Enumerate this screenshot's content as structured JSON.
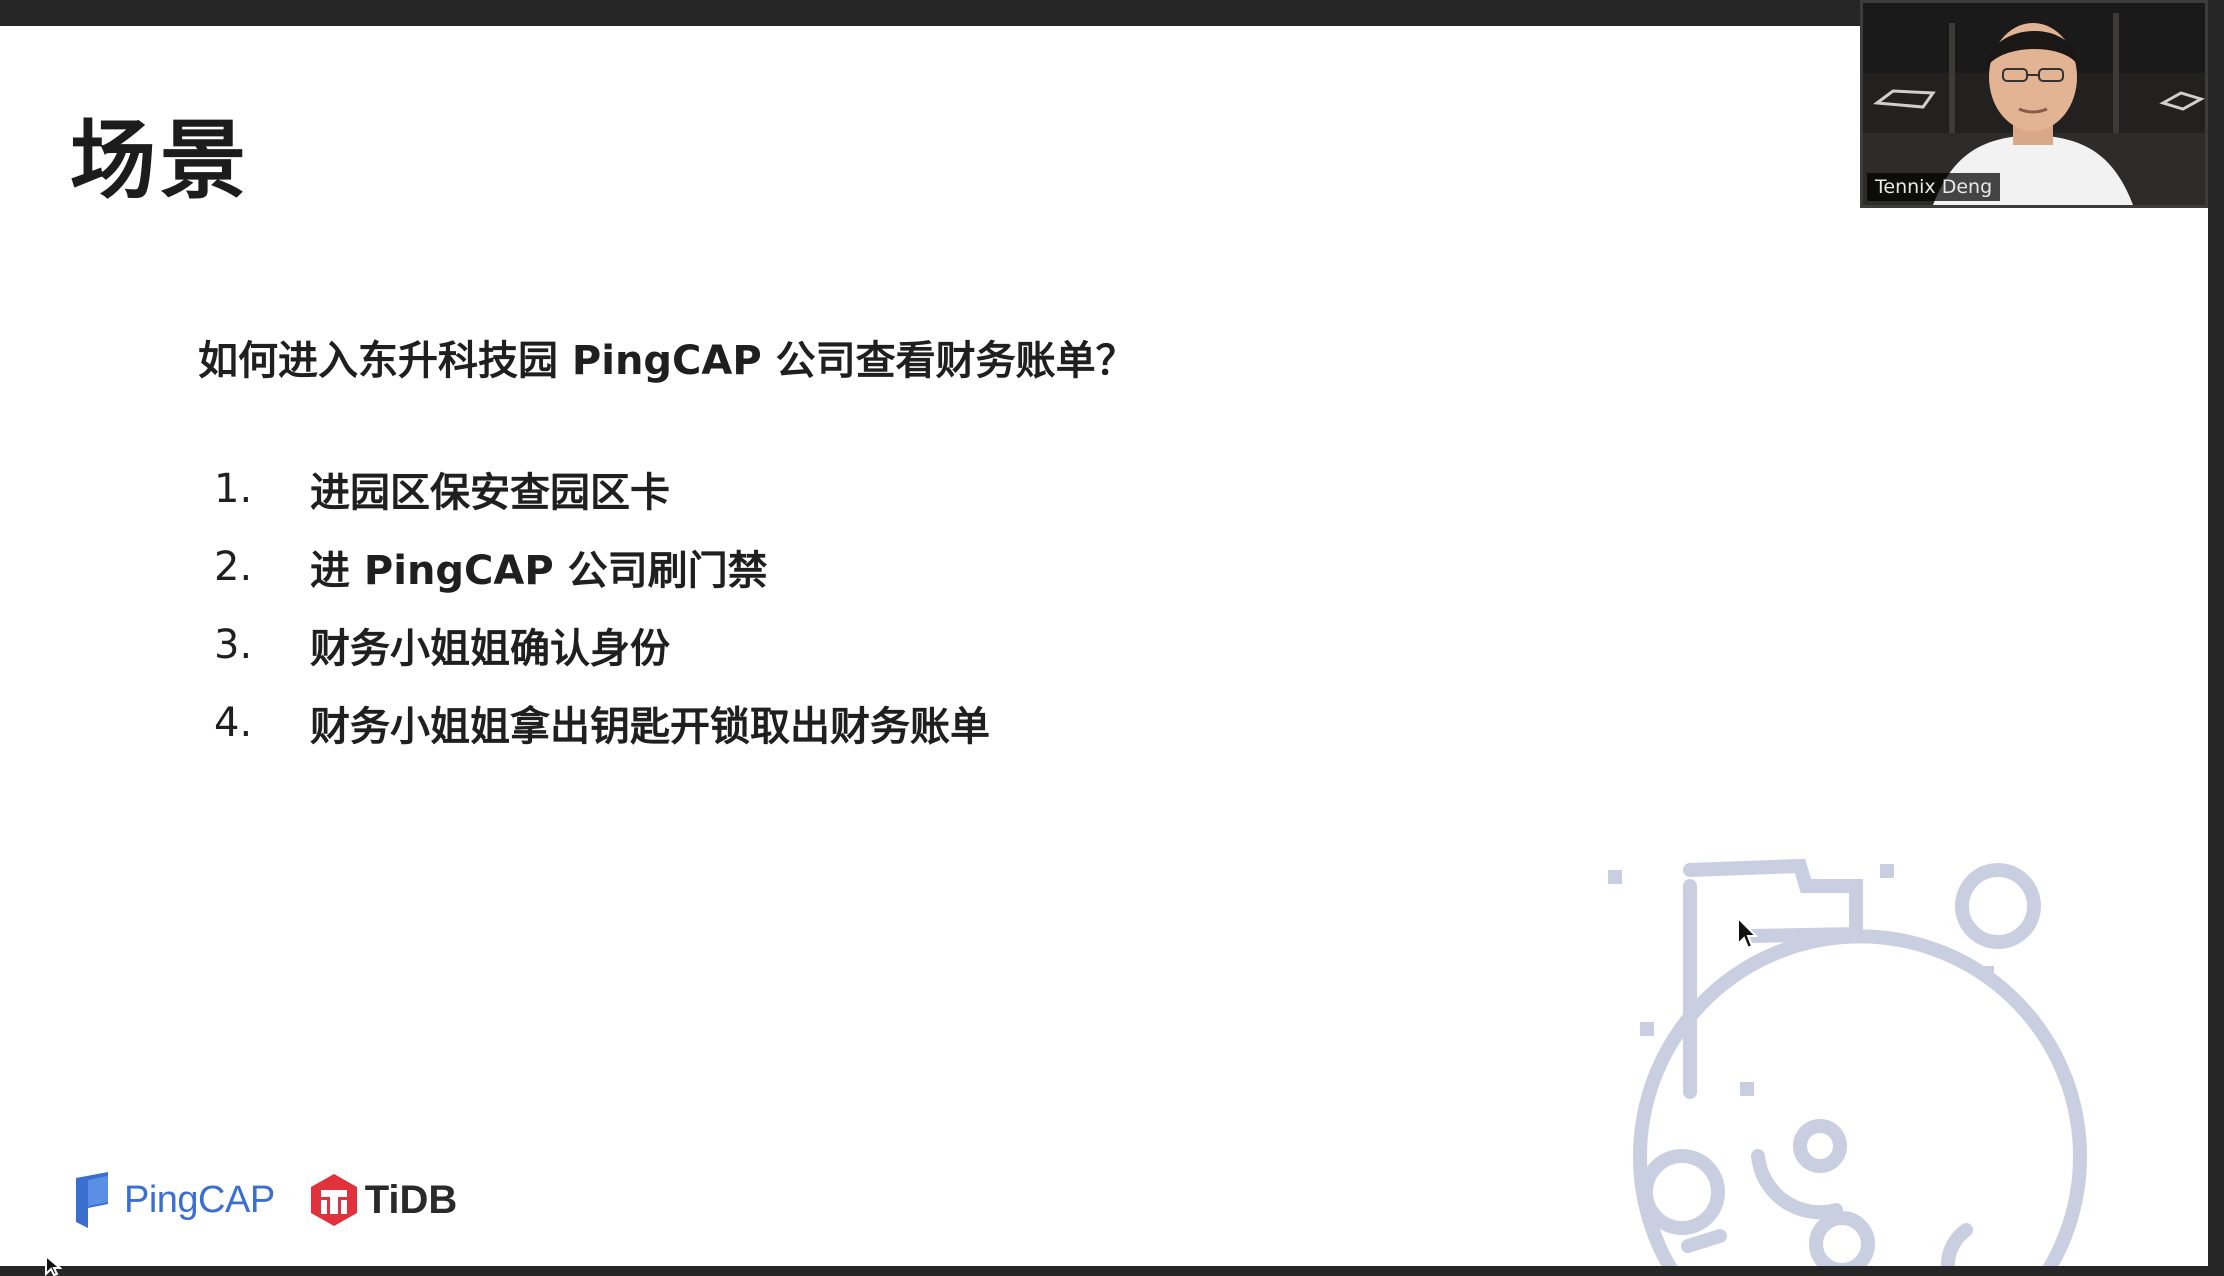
{
  "slide": {
    "title": "场景",
    "question": "如何进入东升科技园 PingCAP 公司查看财务账单？",
    "steps": [
      {
        "num": "1.",
        "text": "进园区保安查园区卡"
      },
      {
        "num": "2.",
        "text": "进 PingCAP 公司刷门禁"
      },
      {
        "num": "3.",
        "text": "财务小姐姐确认身份"
      },
      {
        "num": "4.",
        "text": "财务小姐姐拿出钥匙开锁取出财务账单"
      }
    ],
    "logos": {
      "pingcap": "PingCAP",
      "tidb": "TiDB"
    }
  },
  "video": {
    "participant_name": "Tennix Deng"
  },
  "colors": {
    "pingcap_blue": "#3a6fcf",
    "tidb_red": "#e0313c",
    "illustration": "#c9cfe0"
  }
}
